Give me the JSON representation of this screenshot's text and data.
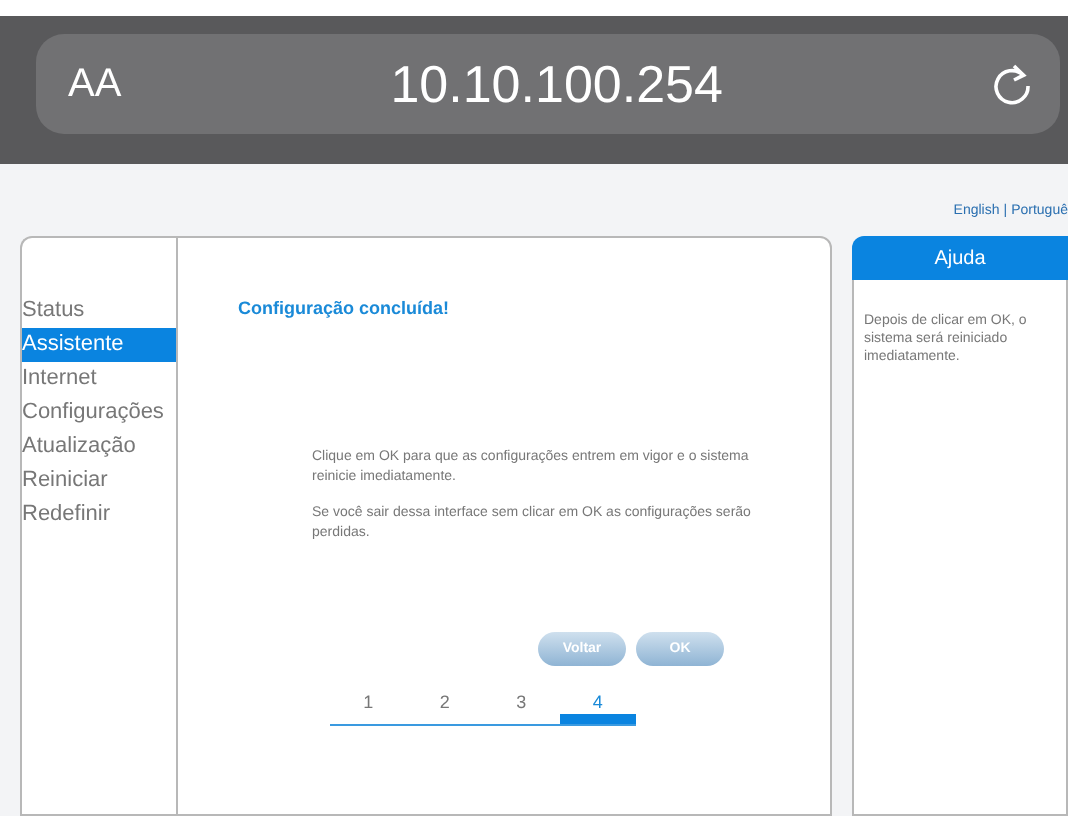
{
  "browser": {
    "text_size_button": "AA",
    "url": "10.10.100.254"
  },
  "languages": [
    {
      "label": "English"
    },
    {
      "label": "|"
    },
    {
      "label": "Portuguê"
    }
  ],
  "sidebar": {
    "items": [
      {
        "label": "Status",
        "selected": false
      },
      {
        "label": "Assistente",
        "selected": true
      },
      {
        "label": "Internet",
        "selected": false
      },
      {
        "label": "Configurações",
        "selected": false
      },
      {
        "label": "Atualização",
        "selected": false
      },
      {
        "label": "Reiniciar",
        "selected": false
      },
      {
        "label": "Redefinir",
        "selected": false
      }
    ]
  },
  "main": {
    "title": "Configuração concluída!",
    "paragraphs": [
      "Clique em OK para que as configurações entrem em vigor e o sistema reinicie imediatamente.",
      "Se você sair dessa interface sem clicar em OK as configurações serão perdidas."
    ],
    "buttons": [
      "Voltar",
      "OK"
    ],
    "steps": [
      {
        "label": "1",
        "selected": false
      },
      {
        "label": "2",
        "selected": false
      },
      {
        "label": "3",
        "selected": false
      },
      {
        "label": "4",
        "selected": true
      }
    ]
  },
  "help": {
    "title": "Ajuda",
    "text": "Depois de clicar em OK, o sistema será reiniciado imediatamente."
  }
}
